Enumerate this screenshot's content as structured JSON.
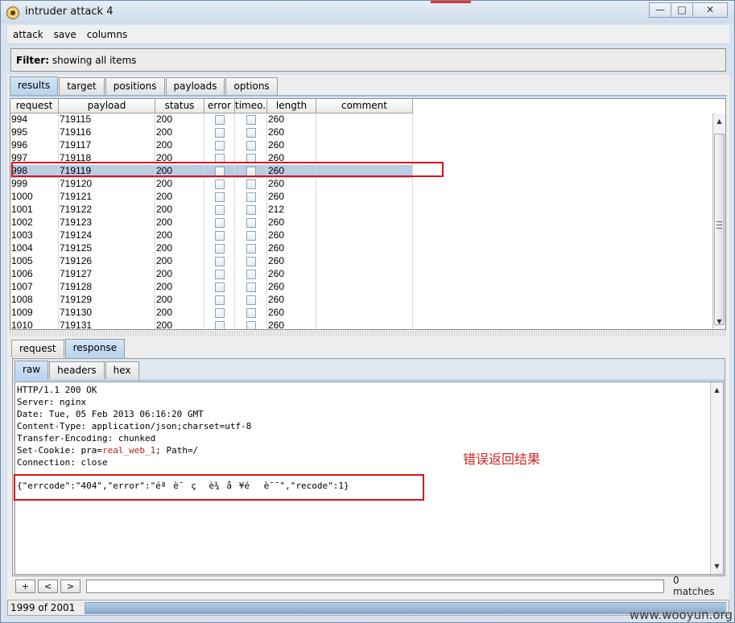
{
  "window": {
    "title": "intruder attack 4",
    "buttons": [
      "—",
      "□",
      "✕"
    ]
  },
  "menu": [
    "attack",
    "save",
    "columns"
  ],
  "filter": {
    "label": "Filter:",
    "value": "showing all items"
  },
  "tabs": [
    "results",
    "target",
    "positions",
    "payloads",
    "options"
  ],
  "table": {
    "columns": [
      "request",
      "payload",
      "status",
      "error",
      "timeo...",
      "length",
      "comment"
    ],
    "rows": [
      {
        "request": "994",
        "payload": "719115",
        "status": "200",
        "length": "260"
      },
      {
        "request": "995",
        "payload": "719116",
        "status": "200",
        "length": "260"
      },
      {
        "request": "996",
        "payload": "719117",
        "status": "200",
        "length": "260"
      },
      {
        "request": "997",
        "payload": "719118",
        "status": "200",
        "length": "260"
      },
      {
        "request": "998",
        "payload": "719119",
        "status": "200",
        "length": "260",
        "selected": true
      },
      {
        "request": "999",
        "payload": "719120",
        "status": "200",
        "length": "260"
      },
      {
        "request": "1000",
        "payload": "719121",
        "status": "200",
        "length": "260"
      },
      {
        "request": "1001",
        "payload": "719122",
        "status": "200",
        "length": "212"
      },
      {
        "request": "1002",
        "payload": "719123",
        "status": "200",
        "length": "260"
      },
      {
        "request": "1003",
        "payload": "719124",
        "status": "200",
        "length": "260"
      },
      {
        "request": "1004",
        "payload": "719125",
        "status": "200",
        "length": "260"
      },
      {
        "request": "1005",
        "payload": "719126",
        "status": "200",
        "length": "260"
      },
      {
        "request": "1006",
        "payload": "719127",
        "status": "200",
        "length": "260"
      },
      {
        "request": "1007",
        "payload": "719128",
        "status": "200",
        "length": "260"
      },
      {
        "request": "1008",
        "payload": "719129",
        "status": "200",
        "length": "260"
      },
      {
        "request": "1009",
        "payload": "719130",
        "status": "200",
        "length": "260"
      },
      {
        "request": "1010",
        "payload": "719131",
        "status": "200",
        "length": "260"
      }
    ]
  },
  "detail_tabs": [
    "request",
    "response"
  ],
  "view_tabs": [
    "raw",
    "headers",
    "hex"
  ],
  "response": {
    "line1": "HTTP/1.1 200 OK",
    "line2": "Server: nginx",
    "line3": "Date: Tue, 05 Feb 2013 06:16:20 GMT",
    "line4": "Content-Type: application/json;charset=utf-8",
    "line5": "Transfer-Encoding: chunked",
    "cookie_prefix": "Set-Cookie: pra=",
    "cookie_value": "real_web_1",
    "cookie_suffix": "; Path=/",
    "line7": "Connection: close",
    "body": "{\"errcode\":\"404\",\"error\":\"éªè¯ç è¾å¥éè¯¯\",\"recode\":1}"
  },
  "annotation": "错误返回结果",
  "search": {
    "buttons": [
      "+",
      "<",
      ">"
    ],
    "value": "",
    "matches": "0 matches"
  },
  "status": {
    "text": "1999 of 2001",
    "progress": 0.999
  },
  "watermark": "www.wooyun.org"
}
